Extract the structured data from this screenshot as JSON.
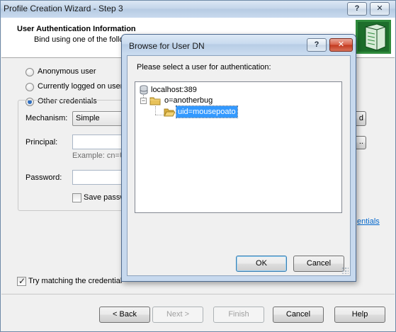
{
  "wizard": {
    "title": "Profile Creation Wizard - Step 3",
    "caption_buttons": {
      "help": "?",
      "close": "✕"
    },
    "header": {
      "title": "User Authentication Information",
      "subtitle": "Bind using one of the follo"
    },
    "options": {
      "anonymous": "Anonymous user",
      "current": "Currently logged on user",
      "other": "Other credentials"
    },
    "selected_option": "other",
    "fields": {
      "mechanism_label": "Mechanism:",
      "mechanism_value": "Simple",
      "principal_label": "Principal:",
      "principal_value": "",
      "principal_example": "Example: cn=U",
      "password_label": "Password:",
      "password_value": "",
      "save_password_label": "Save passw"
    },
    "partial_button_right": "d",
    "browse_partial_button": "..",
    "credentials_link": "entials",
    "try_matching_label": "Try matching the credential",
    "try_matching_checked": true,
    "footer": {
      "back": "< Back",
      "next": "Next >",
      "finish": "Finish",
      "cancel": "Cancel",
      "help": "Help"
    }
  },
  "browse_dialog": {
    "title": "Browse for User DN",
    "caption_buttons": {
      "help": "?",
      "close": "✕"
    },
    "instruction": "Please select a user for authentication:",
    "tree": {
      "server": "localhost:389",
      "org": "o=anotherbug",
      "user": "uid=mousepoato",
      "selected": "user"
    },
    "ok": "OK",
    "cancel": "Cancel"
  },
  "colors": {
    "selection": "#3399ff",
    "link": "#0066cc",
    "folder": "#e8c25a"
  }
}
